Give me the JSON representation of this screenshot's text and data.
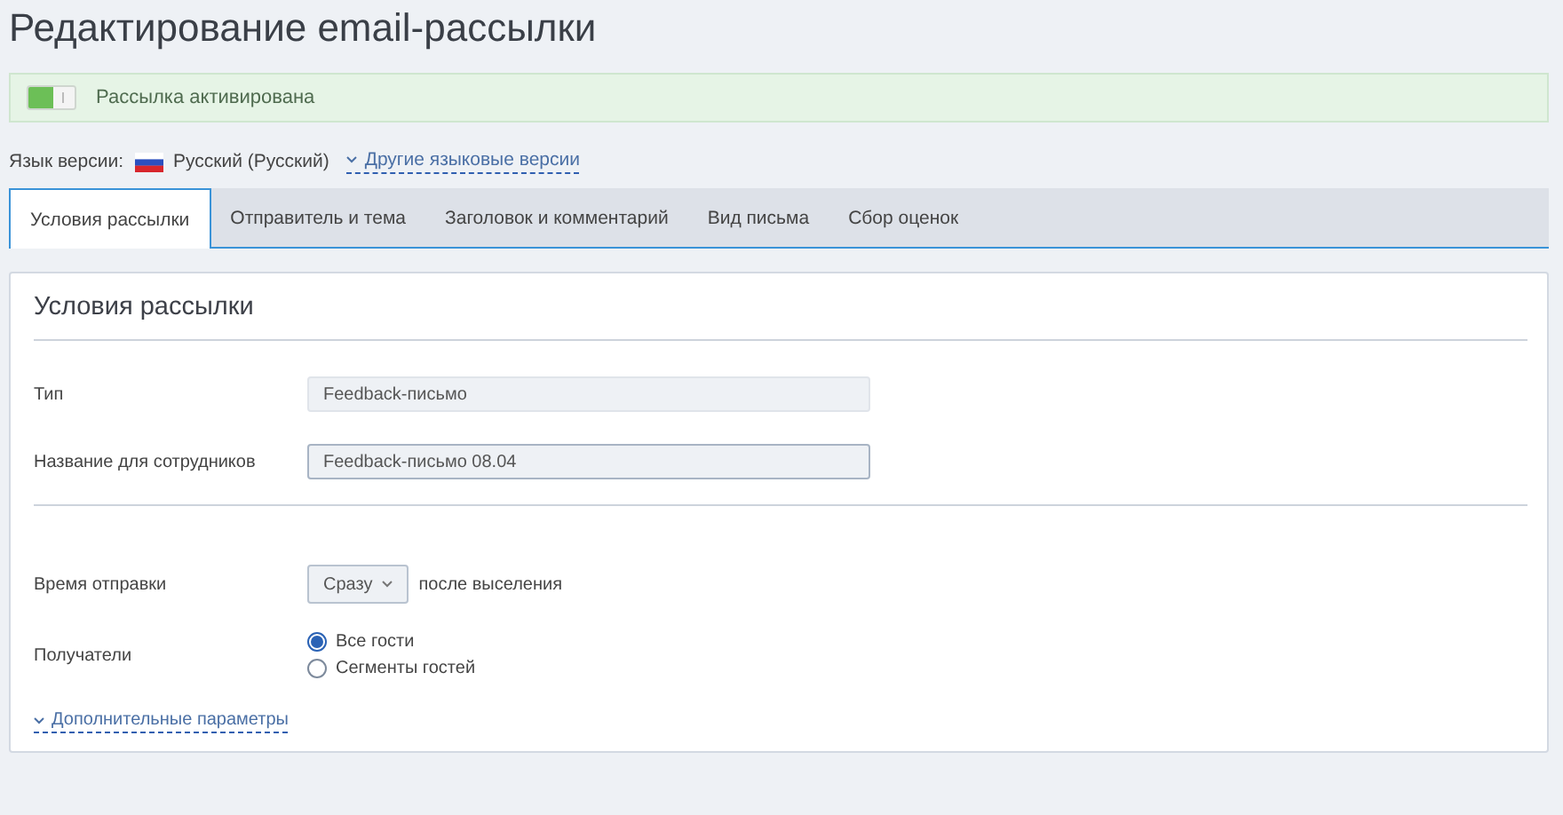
{
  "page": {
    "title": "Редактирование email-рассылки"
  },
  "activation": {
    "on": true,
    "label": "Рассылка активирована"
  },
  "language": {
    "label": "Язык версии:",
    "current": "Русский (Русский)",
    "other_link": "Другие языковые версии"
  },
  "tabs": [
    {
      "label": "Условия рассылки",
      "selected": true
    },
    {
      "label": "Отправитель и тема",
      "selected": false
    },
    {
      "label": "Заголовок и комментарий",
      "selected": false
    },
    {
      "label": "Вид письма",
      "selected": false
    },
    {
      "label": "Сбор оценок",
      "selected": false
    }
  ],
  "card": {
    "title": "Условия рассылки",
    "fields": [
      {
        "kind": "readonly",
        "label": "Тип",
        "value": "Feedback-письмо"
      },
      {
        "kind": "text",
        "label": "Название для сотрудников",
        "value": "Feedback-письмо 08.04"
      }
    ],
    "send_time": {
      "label": "Время отправки",
      "dropdown": "Сразу",
      "suffix": "после выселения"
    },
    "recipients": {
      "label": "Получатели",
      "options": [
        {
          "label": "Все гости",
          "selected": true
        },
        {
          "label": "Сегменты гостей",
          "selected": false
        }
      ]
    },
    "more_link": "Дополнительные параметры"
  }
}
